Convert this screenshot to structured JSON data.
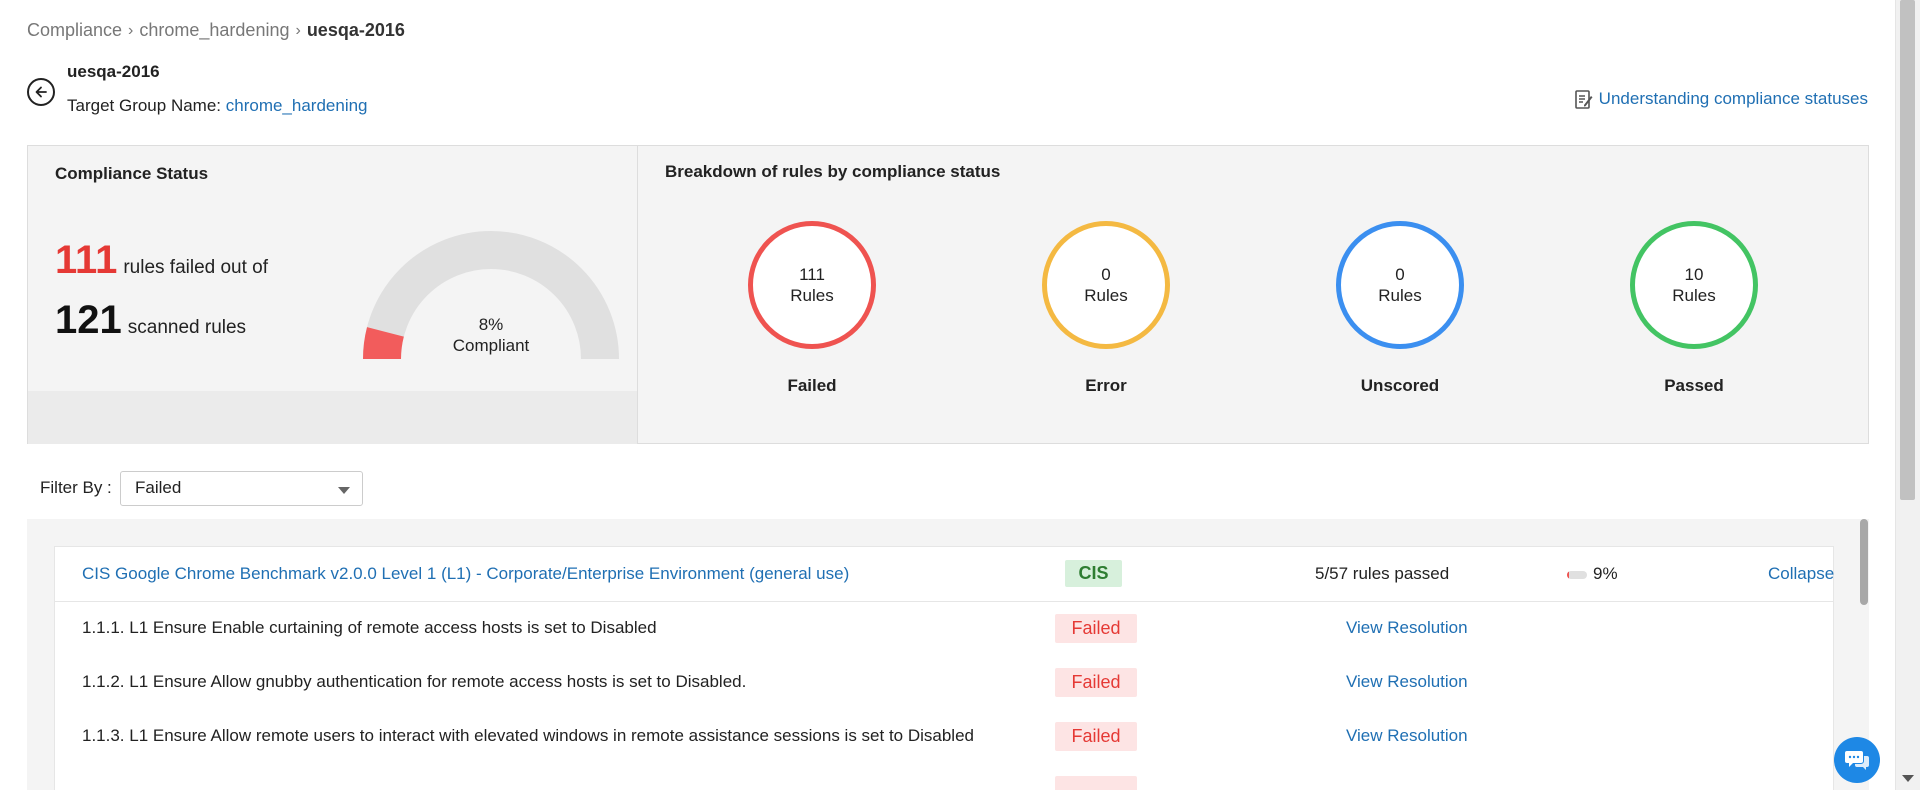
{
  "breadcrumb": [
    "Compliance",
    "chrome_hardening",
    "uesqa-2016"
  ],
  "header": {
    "title": "uesqa-2016",
    "target_label": "Target Group Name:",
    "target_value": "chrome_hardening",
    "help_link": "Understanding compliance statuses"
  },
  "compliance_status": {
    "title": "Compliance Status",
    "failed_count": "111",
    "failed_text": "rules failed out of",
    "scanned_count": "121",
    "scanned_text": "scanned rules",
    "gauge_percent": "8%",
    "gauge_label": "Compliant",
    "gauge_fraction": 0.08,
    "gauge_color": "#f25c5c"
  },
  "breakdown": {
    "title": "Breakdown of rules by compliance status",
    "items": [
      {
        "count": "111",
        "unit": "Rules",
        "label": "Failed",
        "color": "#ef5350"
      },
      {
        "count": "0",
        "unit": "Rules",
        "label": "Error",
        "color": "#f4b942"
      },
      {
        "count": "0",
        "unit": "Rules",
        "label": "Unscored",
        "color": "#3b8ff0"
      },
      {
        "count": "10",
        "unit": "Rules",
        "label": "Passed",
        "color": "#43c463"
      }
    ]
  },
  "filter": {
    "label": "Filter By :",
    "selected": "Failed"
  },
  "group": {
    "title": "CIS Google Chrome Benchmark v2.0.0 Level 1 (L1) - Corporate/Enterprise Environment (general use)",
    "badge": "CIS",
    "passed_text": "5/57 rules passed",
    "percent": "9%",
    "progress_fraction": 0.09,
    "collapse": "Collapse"
  },
  "rules": [
    {
      "text": "1.1.1. L1 Ensure Enable curtaining of remote access hosts is set to Disabled",
      "status": "Failed",
      "action": "View Resolution"
    },
    {
      "text": "1.1.2. L1 Ensure Allow gnubby authentication for remote access hosts is set to Disabled.",
      "status": "Failed",
      "action": "View Resolution"
    },
    {
      "text": "1.1.3. L1 Ensure Allow remote users to interact with elevated windows in remote assistance sessions is set to Disabled",
      "status": "Failed",
      "action": "View Resolution"
    }
  ]
}
